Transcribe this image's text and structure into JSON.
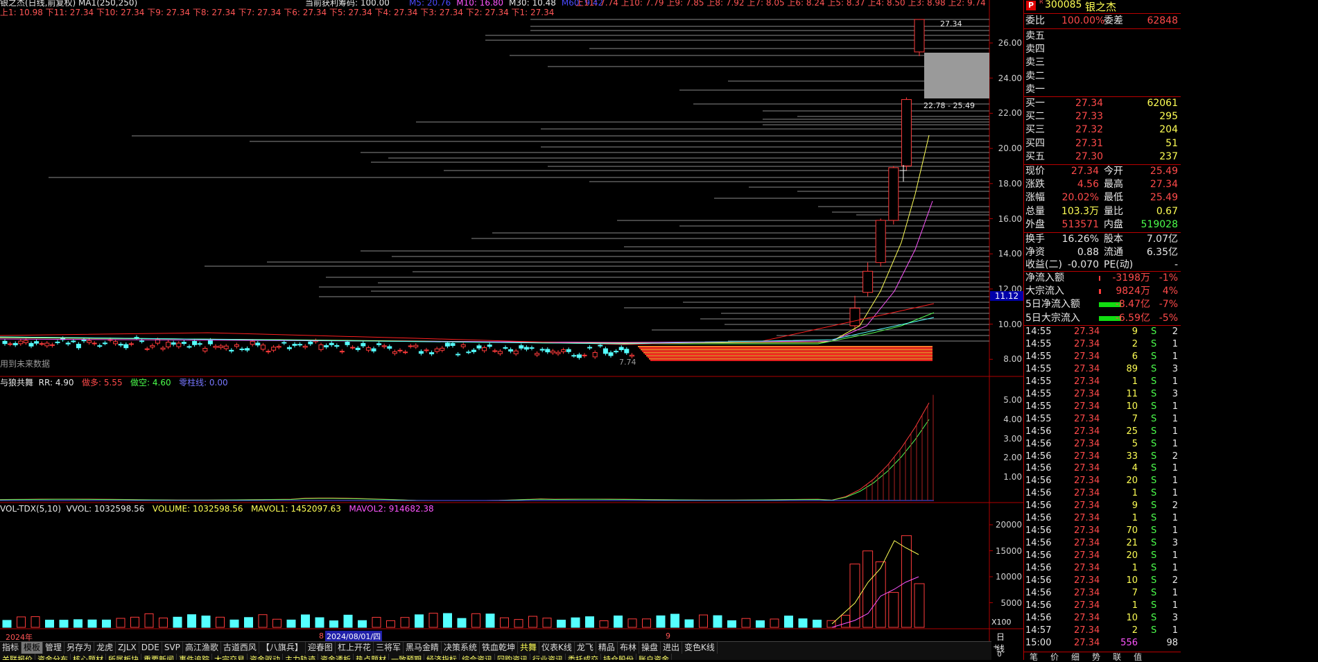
{
  "title": "银之杰(日线,前复权) MA1(250,250)",
  "header_strip": {
    "profit_chips": "当前获利筹码: 100.00",
    "ma": [
      {
        "label": "M5: 20.76",
        "color": "#4a4aff"
      },
      {
        "label": "M10: 16.80",
        "color": "#ff55ff"
      },
      {
        "label": "M30: 10.48",
        "color": "#e8e8e8"
      },
      {
        "label": "M60: 9.42",
        "color": "#4a4aff"
      }
    ],
    "upper_levels": "上11: 7.74  上10: 7.79  上9: 7.85  上8: 7.92  上7: 8.05  上6: 8.24  上5: 8.37  上4: 8.50  上3: 8.98  上2: 9.74",
    "lower_levels": "上1: 10.98  下11: 27.34  下10: 27.34  下9: 27.34  下8: 27.34  下7: 27.34  下6: 27.34  下5: 27.34  下4: 27.34  下3: 27.34  下2: 27.34  下1: 27.34"
  },
  "main_chart": {
    "y_ticks": [
      "26.00",
      "24.00",
      "22.00",
      "20.00",
      "18.00",
      "16.00",
      "14.00",
      "12.00",
      "10.00",
      "8.00"
    ],
    "current_price_tag": "11.12",
    "high_label": "27.34",
    "range_label": "22.78 - 25.49",
    "low_label": "7.74",
    "future_note": "用到未来数据"
  },
  "indicator": {
    "name": "与狼共舞",
    "rr": "RR: 4.90",
    "long": "做多: 5.55",
    "short": "做空: 4.60",
    "zero": "零柱线: 0.00",
    "y_ticks": [
      "5.00",
      "4.00",
      "3.00",
      "2.00",
      "1.00"
    ]
  },
  "volume": {
    "name": "VOL-TDX(5,10)",
    "vvol": "VVOL: 1032598.56",
    "volume": "VOLUME: 1032598.56",
    "mavol1": "MAVOL1: 1452097.63",
    "mavol2": "MAVOL2: 914682.38",
    "y_ticks": [
      "20000",
      "15000",
      "10000",
      "5000"
    ],
    "unit": "X100"
  },
  "x_axis": {
    "year": "2024年",
    "month8": "8",
    "cursor_date": "2024/08/01/四",
    "month9": "9",
    "period": "日线"
  },
  "tabs_row1": [
    "指标",
    "模板",
    "管理",
    "另存为",
    "龙虎",
    "ZJLX",
    "DDE",
    "SVP",
    "高江渔歌",
    "古道西风",
    "【八旗兵】",
    "迎春图",
    "杠上开花",
    "三将军",
    "黑马金睛",
    "决策系统",
    "铁血乾坤",
    "共舞",
    "仪表K线",
    "龙飞",
    "精品",
    "布林",
    "操盘",
    "进出",
    "变色K线"
  ],
  "tabs_row1_active": "模板",
  "tabs_row1_highlight": "共舞",
  "tabs_row2": [
    "关联报价",
    "资金分布",
    "核心题材",
    "所属板块",
    "重要新闻",
    "事件追踪",
    "大宗交易",
    "资金驱动",
    "主力轨迹",
    "资金透析",
    "热点题材",
    "一致预期",
    "经济指标",
    "综合资讯",
    "回购资讯",
    "行业资讯",
    "委托成交",
    "持仓股份",
    "账户资金"
  ],
  "quote": {
    "code": "300085",
    "name": "银之杰",
    "ratio_label": "委比",
    "ratio": "100.00%",
    "diff_label": "委差",
    "diff": "62848",
    "asks": [
      {
        "label": "卖五",
        "price": "",
        "vol": ""
      },
      {
        "label": "卖四",
        "price": "",
        "vol": ""
      },
      {
        "label": "卖三",
        "price": "",
        "vol": ""
      },
      {
        "label": "卖二",
        "price": "",
        "vol": ""
      },
      {
        "label": "卖一",
        "price": "",
        "vol": ""
      }
    ],
    "bids": [
      {
        "label": "买一",
        "price": "27.34",
        "vol": "62061"
      },
      {
        "label": "买二",
        "price": "27.33",
        "vol": "295"
      },
      {
        "label": "买三",
        "price": "27.32",
        "vol": "204"
      },
      {
        "label": "买四",
        "price": "27.31",
        "vol": "51"
      },
      {
        "label": "买五",
        "price": "27.30",
        "vol": "237"
      }
    ],
    "stats": [
      {
        "l1": "现价",
        "v1": "27.34",
        "c1": "red",
        "l2": "今开",
        "v2": "25.49",
        "c2": "red"
      },
      {
        "l1": "涨跌",
        "v1": "4.56",
        "c1": "red",
        "l2": "最高",
        "v2": "27.34",
        "c2": "red"
      },
      {
        "l1": "涨幅",
        "v1": "20.02%",
        "c1": "red",
        "l2": "最低",
        "v2": "25.49",
        "c2": "red"
      },
      {
        "l1": "总量",
        "v1": "103.3万",
        "c1": "yel",
        "l2": "量比",
        "v2": "0.67",
        "c2": "yel"
      },
      {
        "l1": "外盘",
        "v1": "513571",
        "c1": "red",
        "l2": "内盘",
        "v2": "519028",
        "c2": "grn"
      }
    ],
    "stats2": [
      {
        "l1": "换手",
        "v1": "16.26%",
        "l2": "股本",
        "v2": "7.07亿"
      },
      {
        "l1": "净资",
        "v1": "0.88",
        "l2": "流通",
        "v2": "6.35亿"
      },
      {
        "l1": "收益(二)",
        "v1": "-0.070",
        "l2": "PE(动)",
        "v2": "-"
      }
    ],
    "flows": [
      {
        "label": "净流入额",
        "value": "-3198万",
        "pct": "-1%",
        "bar": "#ff3b3b",
        "bar_fill": 0.05
      },
      {
        "label": "大宗流入",
        "value": "9824万",
        "pct": "4%",
        "bar": "#ff3b3b",
        "bar_fill": 0.1
      },
      {
        "label": "5日净流入额",
        "value": "-8.47亿",
        "pct": "-7%",
        "bar": "#11dd11",
        "bar_fill": 1.0
      },
      {
        "label": "5日大宗流入",
        "value": "-6.59亿",
        "pct": "-5%",
        "bar": "#11dd11",
        "bar_fill": 1.0
      }
    ],
    "ticks": [
      {
        "t": "14:55",
        "p": "27.34",
        "v": "9",
        "s": "S",
        "n": "2"
      },
      {
        "t": "14:55",
        "p": "27.34",
        "v": "2",
        "s": "S",
        "n": "1"
      },
      {
        "t": "14:55",
        "p": "27.34",
        "v": "6",
        "s": "S",
        "n": "1"
      },
      {
        "t": "14:55",
        "p": "27.34",
        "v": "89",
        "s": "S",
        "n": "3"
      },
      {
        "t": "14:55",
        "p": "27.34",
        "v": "1",
        "s": "S",
        "n": "1"
      },
      {
        "t": "14:55",
        "p": "27.34",
        "v": "11",
        "s": "S",
        "n": "3"
      },
      {
        "t": "14:55",
        "p": "27.34",
        "v": "10",
        "s": "S",
        "n": "1"
      },
      {
        "t": "14:55",
        "p": "27.34",
        "v": "7",
        "s": "S",
        "n": "1"
      },
      {
        "t": "14:56",
        "p": "27.34",
        "v": "25",
        "s": "S",
        "n": "1"
      },
      {
        "t": "14:56",
        "p": "27.34",
        "v": "5",
        "s": "S",
        "n": "1"
      },
      {
        "t": "14:56",
        "p": "27.34",
        "v": "33",
        "s": "S",
        "n": "2"
      },
      {
        "t": "14:56",
        "p": "27.34",
        "v": "4",
        "s": "S",
        "n": "1"
      },
      {
        "t": "14:56",
        "p": "27.34",
        "v": "20",
        "s": "S",
        "n": "1"
      },
      {
        "t": "14:56",
        "p": "27.34",
        "v": "1",
        "s": "S",
        "n": "1"
      },
      {
        "t": "14:56",
        "p": "27.34",
        "v": "9",
        "s": "S",
        "n": "2"
      },
      {
        "t": "14:56",
        "p": "27.34",
        "v": "1",
        "s": "S",
        "n": "1"
      },
      {
        "t": "14:56",
        "p": "27.34",
        "v": "70",
        "s": "S",
        "n": "1"
      },
      {
        "t": "14:56",
        "p": "27.34",
        "v": "21",
        "s": "S",
        "n": "3"
      },
      {
        "t": "14:56",
        "p": "27.34",
        "v": "20",
        "s": "S",
        "n": "1"
      },
      {
        "t": "14:56",
        "p": "27.34",
        "v": "1",
        "s": "S",
        "n": "1"
      },
      {
        "t": "14:56",
        "p": "27.34",
        "v": "10",
        "s": "S",
        "n": "2"
      },
      {
        "t": "14:56",
        "p": "27.34",
        "v": "7",
        "s": "S",
        "n": "1"
      },
      {
        "t": "14:56",
        "p": "27.34",
        "v": "1",
        "s": "S",
        "n": "1"
      },
      {
        "t": "14:56",
        "p": "27.34",
        "v": "10",
        "s": "S",
        "n": "3"
      },
      {
        "t": "14:57",
        "p": "27.34",
        "v": "2",
        "s": "S",
        "n": "1"
      },
      {
        "t": "15:00",
        "p": "27.34",
        "v": "556",
        "s": "",
        "n": "98"
      }
    ],
    "bottom_tabs": [
      "笔",
      "价",
      "细",
      "势",
      "联",
      "值"
    ]
  },
  "colors": {
    "up": "#ff3b3b",
    "down": "#55ffff",
    "grid": "#7a0000",
    "bg": "#000000"
  }
}
